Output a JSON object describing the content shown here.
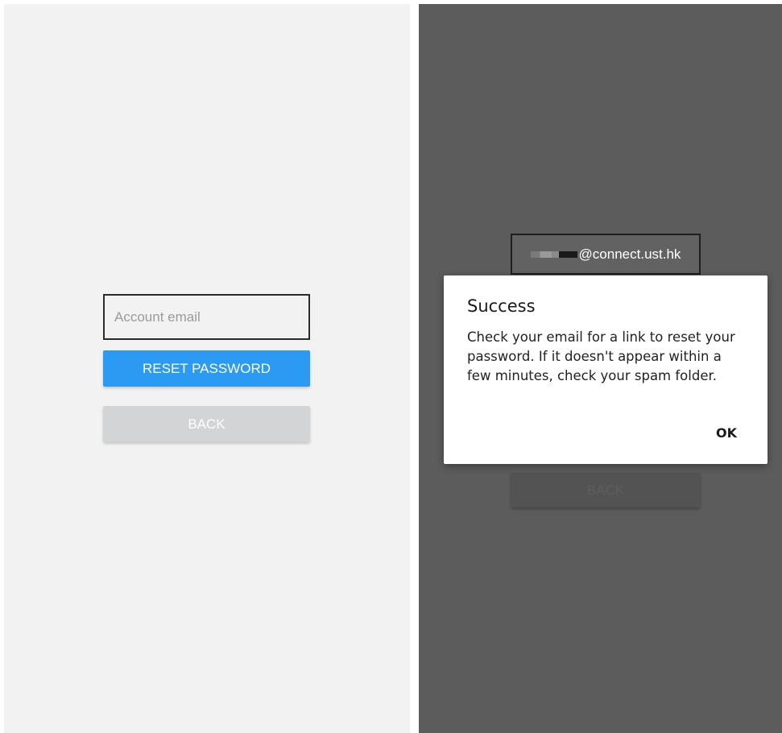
{
  "left_screen": {
    "email_input": {
      "placeholder": "Account email",
      "value": ""
    },
    "reset_button_label": "RESET PASSWORD",
    "back_button_label": "BACK"
  },
  "right_screen": {
    "email_input_value": "@connect.ust.hk",
    "back_button_label": "BACK",
    "dialog": {
      "title": "Success",
      "message": "Check your email for a link to reset your password. If it doesn't appear within a few minutes, check your spam folder.",
      "ok_label": "OK"
    }
  },
  "colors": {
    "accent": "#2b9af3",
    "left_background": "#f2f2f2",
    "overlay_background": "#5c5c5c",
    "disabled_button": "#d3d4d5"
  }
}
